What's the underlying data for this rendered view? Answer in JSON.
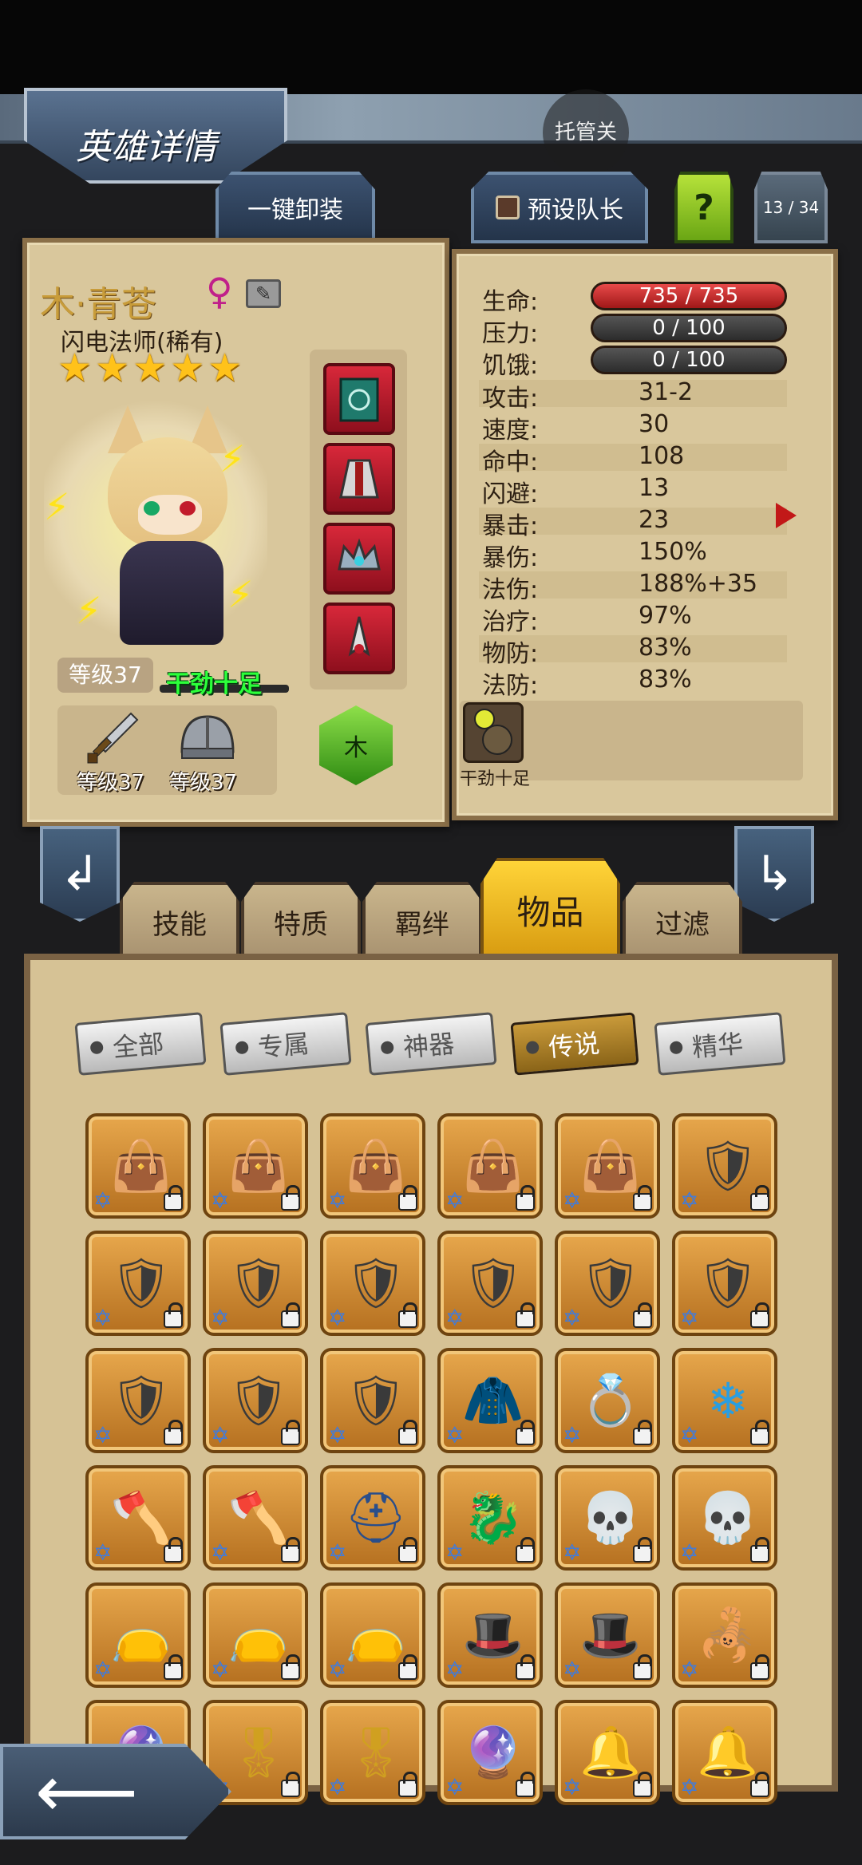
{
  "header": {
    "title": "英雄详情",
    "auto_button": "托管关"
  },
  "top_tabs": {
    "unequip_all": "一键卸装",
    "preset_leader": "预设队长",
    "help": "?",
    "page": "13 / 34"
  },
  "hero": {
    "name": "木·青苍",
    "gender_symbol": "♀",
    "class": "闪电法师(稀有)",
    "stars": 5,
    "level": "等级37",
    "mood": "干劲十足",
    "weapon_level": "等级37",
    "armor_level": "等级37",
    "element": "木"
  },
  "stats": {
    "hp": {
      "label": "生命:",
      "value": "735 / 735"
    },
    "stress": {
      "label": "压力:",
      "value": "0 / 100"
    },
    "hunger": {
      "label": "饥饿:",
      "value": "0 / 100"
    },
    "rows": [
      {
        "label": "攻击:",
        "value": "31-2"
      },
      {
        "label": "速度:",
        "value": "30"
      },
      {
        "label": "命中:",
        "value": "108"
      },
      {
        "label": "闪避:",
        "value": "13"
      },
      {
        "label": "暴击:",
        "value": "23"
      },
      {
        "label": "暴伤:",
        "value": "150%"
      },
      {
        "label": "法伤:",
        "value": "188%+35"
      },
      {
        "label": "治疗:",
        "value": "97%"
      },
      {
        "label": "物防:",
        "value": "83%"
      },
      {
        "label": "法防:",
        "value": "83%"
      }
    ]
  },
  "trait": {
    "label": "干劲十足"
  },
  "tabs": {
    "skills": "技能",
    "traits": "特质",
    "bonds": "羁绊",
    "items": "物品",
    "filter": "过滤"
  },
  "filters": {
    "all": "全部",
    "exclusive": "专属",
    "artifact": "神器",
    "legend": "传说",
    "essence": "精华"
  },
  "colors": {
    "accent_gold": "#d79a10",
    "hp_red": "#c21b2b",
    "panel_parchment": "#d9c79c"
  }
}
